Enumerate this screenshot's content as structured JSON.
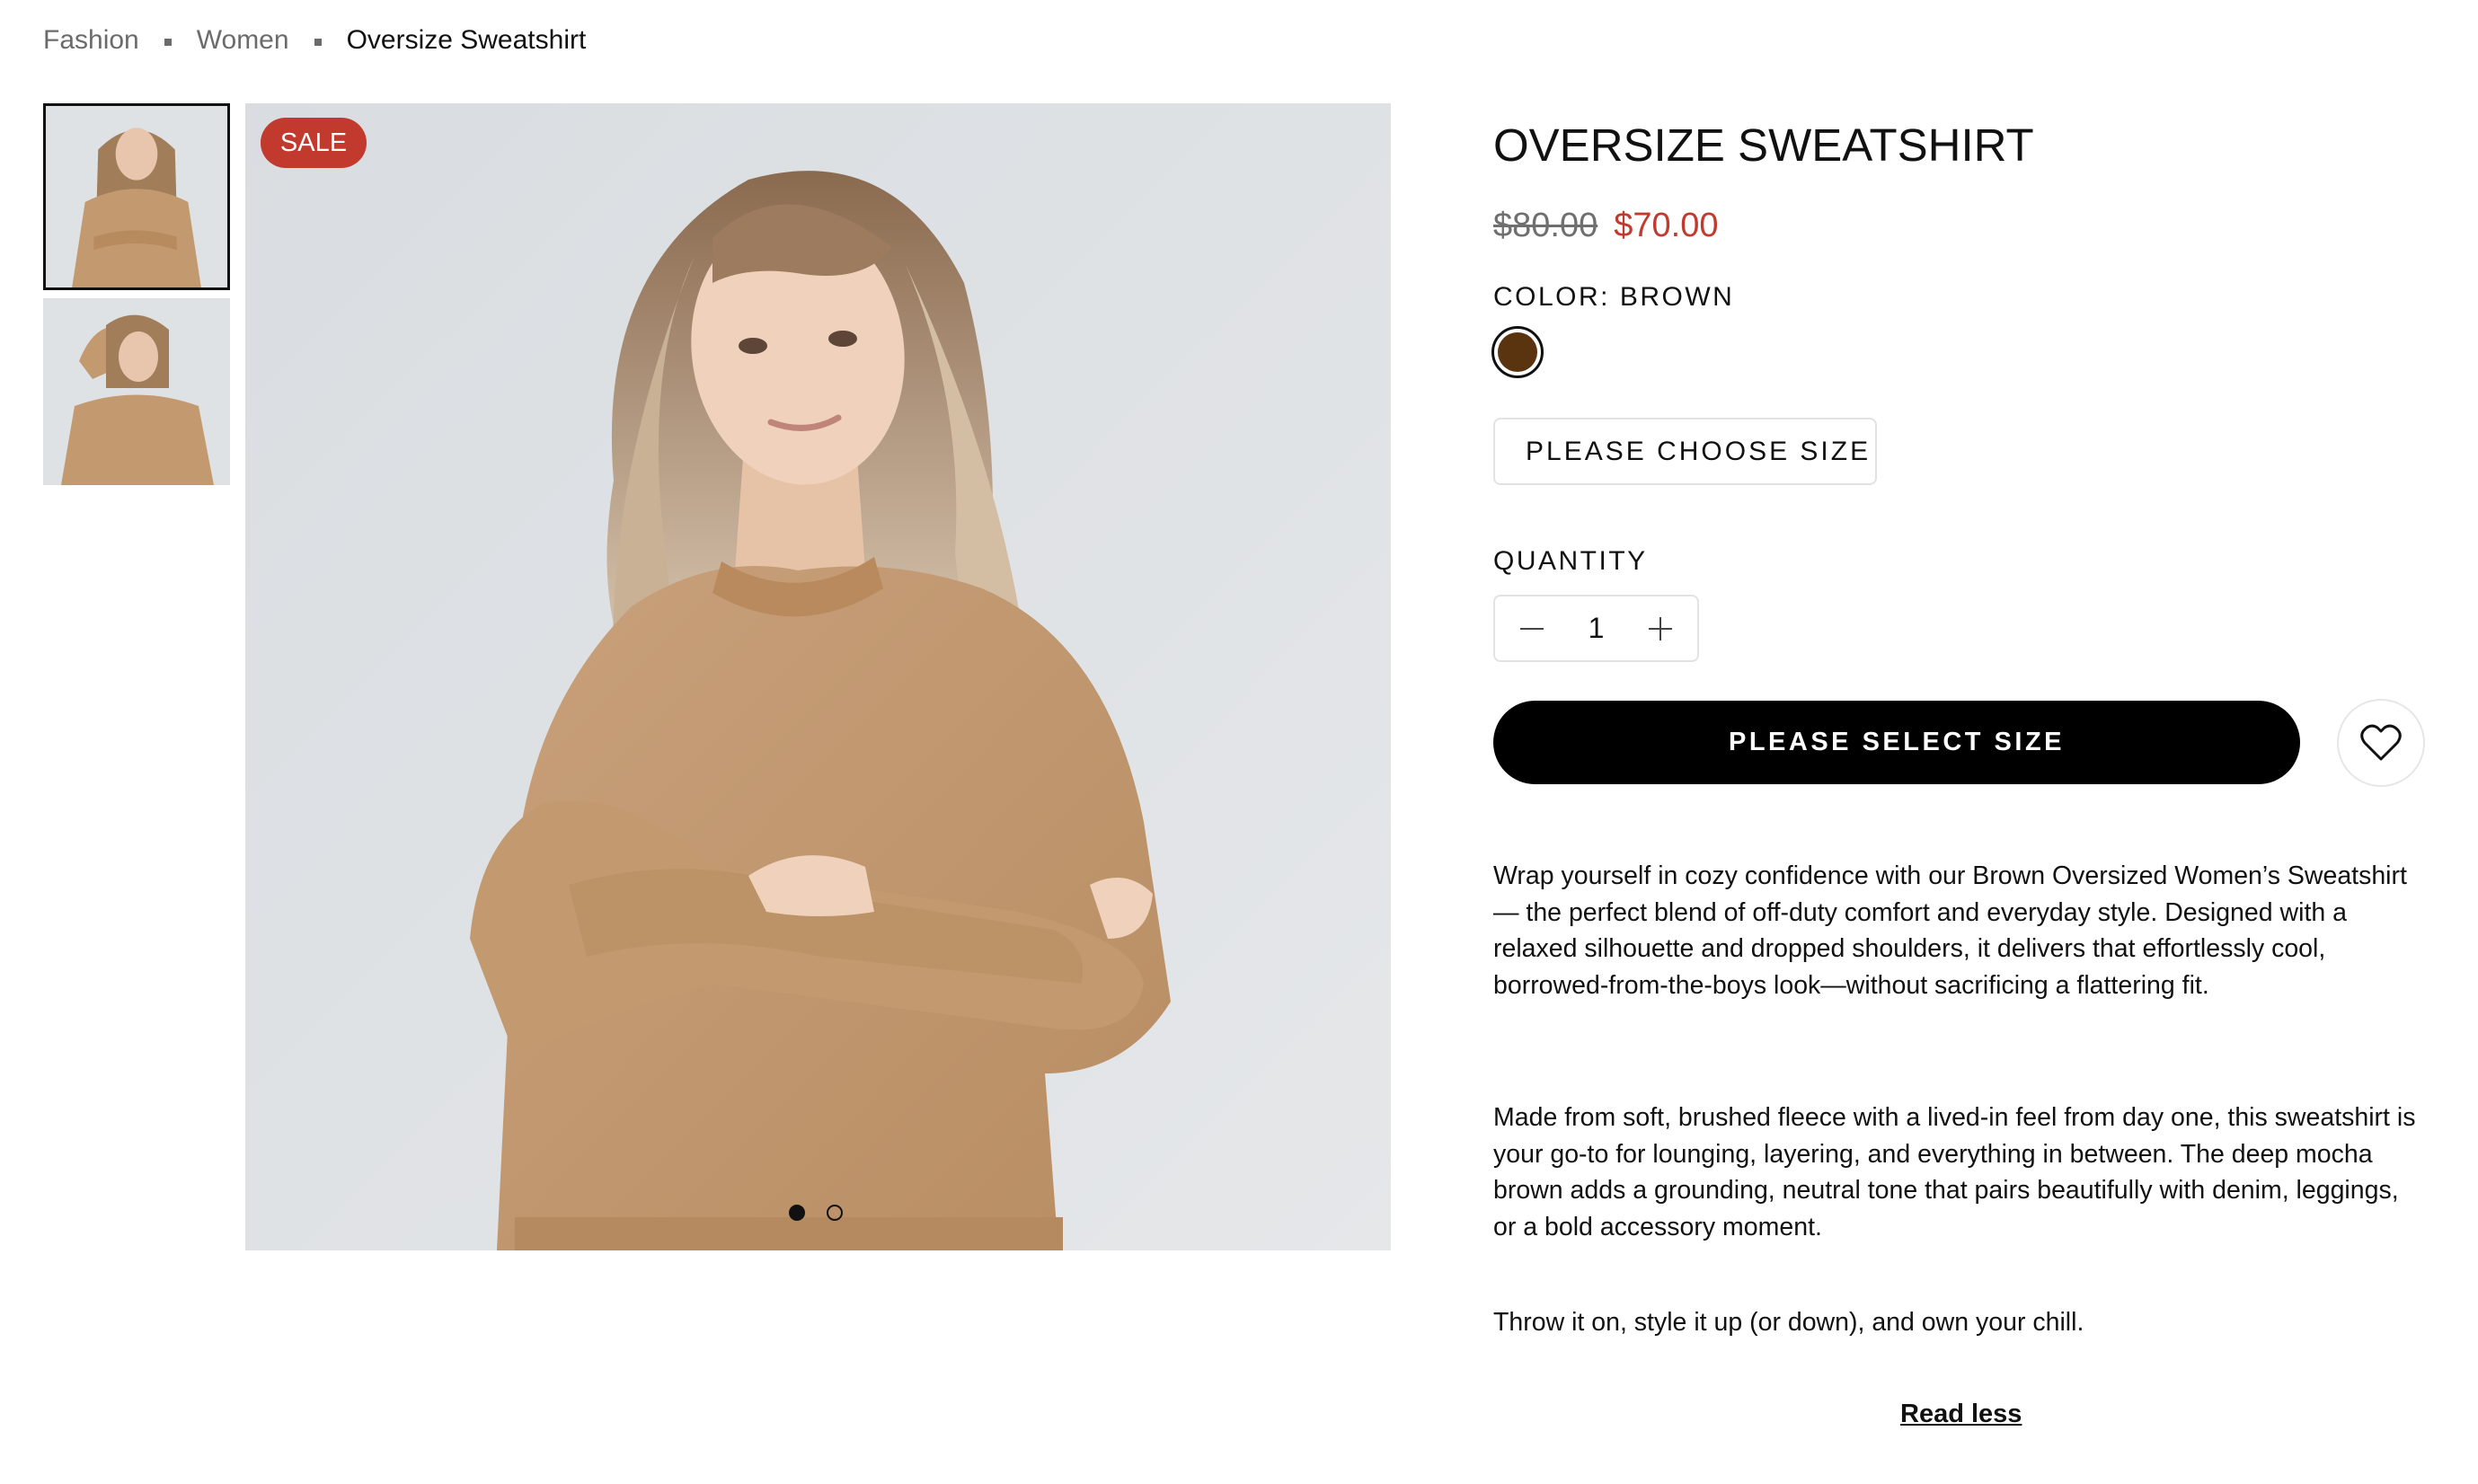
{
  "breadcrumb": {
    "items": [
      "Fashion",
      "Women"
    ],
    "current": "Oversize Sweatshirt"
  },
  "gallery": {
    "sale_badge": "SALE",
    "active_index": 0,
    "slide_count": 2
  },
  "product": {
    "title": "OVERSIZE SWEATSHIRT",
    "price_original": "$80.00",
    "price_sale": "$70.00",
    "color_label": "COLOR: BROWN",
    "color_hex": "#5a330f",
    "size_placeholder": "PLEASE CHOOSE SIZE",
    "quantity_label": "QUANTITY",
    "quantity_value": "1",
    "cta_label": "PLEASE SELECT SIZE",
    "description": [
      "Wrap yourself in cozy confidence with our Brown Oversized Women’s Sweatshirt — the perfect blend of off-duty comfort and everyday style. Designed with a relaxed silhouette and dropped shoulders, it delivers that effortlessly cool, borrowed-from-the-boys look—without sacrificing a flattering fit.",
      "Made from soft, brushed fleece with a lived-in feel from day one, this sweatshirt is your go-to for lounging, layering, and everything in between. The deep mocha brown adds a grounding, neutral tone that pairs beautifully with denim, leggings, or a bold accessory moment.",
      "Throw it on, style it up (or down), and own your chill."
    ],
    "read_less": "Read less"
  },
  "colors": {
    "sale_red": "#c2392e",
    "sweatshirt": "#c39a70",
    "image_bg": "#dde0e3"
  },
  "icons": [
    "minus-icon",
    "plus-icon",
    "heart-icon"
  ]
}
